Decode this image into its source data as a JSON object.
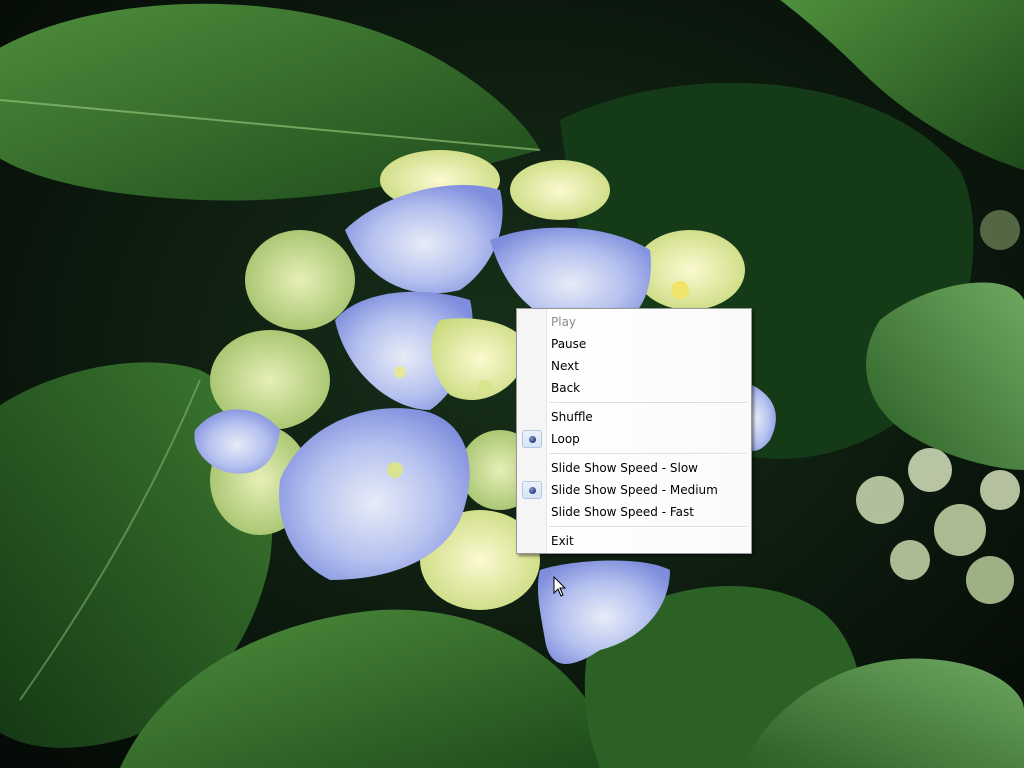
{
  "context_menu": {
    "items": [
      {
        "label": "Play",
        "enabled": false,
        "checked": false
      },
      {
        "label": "Pause",
        "enabled": true,
        "checked": false
      },
      {
        "label": "Next",
        "enabled": true,
        "checked": false
      },
      {
        "label": "Back",
        "enabled": true,
        "checked": false
      },
      {
        "label": "Shuffle",
        "enabled": true,
        "checked": false
      },
      {
        "label": "Loop",
        "enabled": true,
        "checked": true
      },
      {
        "label": "Slide Show Speed - Slow",
        "enabled": true,
        "checked": false
      },
      {
        "label": "Slide Show Speed - Medium",
        "enabled": true,
        "checked": true
      },
      {
        "label": "Slide Show Speed - Fast",
        "enabled": true,
        "checked": false
      },
      {
        "label": "Exit",
        "enabled": true,
        "checked": false
      }
    ]
  },
  "colors": {
    "menu_background": "#ffffff",
    "menu_gutter": "#f5f5f5",
    "menu_border": "#979797",
    "disabled_text": "#8d8d8d",
    "radio_dot": "#2b3a86",
    "leaf_dark": "#1f4a1c",
    "leaf_light": "#3f7a33",
    "petal_blue": "#9aa8e6",
    "petal_yellow": "#e8eca0"
  },
  "background": {
    "subject": "hydrangea-photo"
  }
}
